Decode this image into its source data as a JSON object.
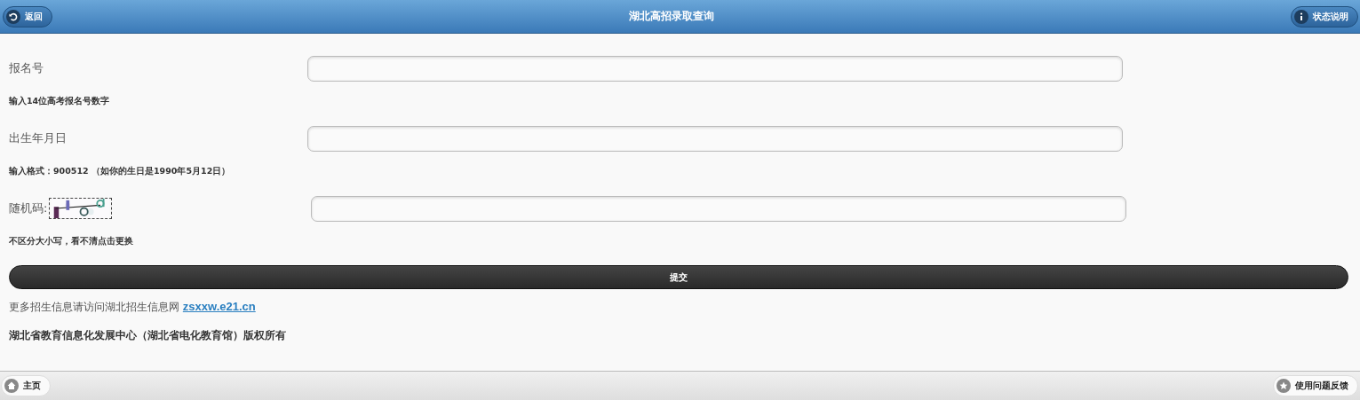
{
  "header": {
    "back_button": "返回",
    "title": "湖北高招录取查询",
    "status_button": "状态说明"
  },
  "fields": [
    {
      "kind": "text",
      "label": "报名号",
      "hint": "输入14位高考报名号数字"
    },
    {
      "kind": "text",
      "label": "出生年月日",
      "hint": "输入格式：900512 （如你的生日是1990年5月12日）"
    },
    {
      "kind": "captcha",
      "label": "随机码:",
      "hint": "不区分大小写，看不清点击更换"
    }
  ],
  "submit_button": "提交",
  "info": {
    "text": "更多招生信息请访问湖北招生信息网",
    "link": "zsxxw.e21.cn"
  },
  "copyright": "湖北省教育信息化发展中心（湖北省电化教育馆）版权所有",
  "footer": {
    "home_button": "主页",
    "feedback_button": "使用问题反馈"
  }
}
